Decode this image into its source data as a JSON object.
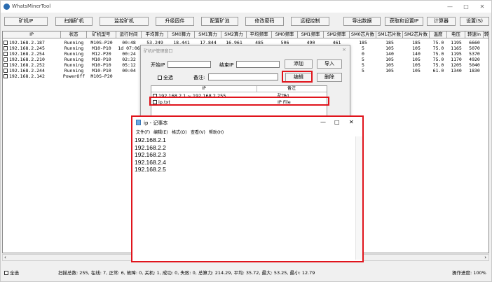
{
  "app": {
    "title": "WhatsMinerTool"
  },
  "window_controls": {
    "minimize": "—",
    "maximize": "□",
    "close": "✕"
  },
  "toolbar": [
    {
      "id": "scan-miner-ip",
      "label": "矿机IP"
    },
    {
      "id": "scan-miner",
      "label": "扫描矿机"
    },
    {
      "id": "monitor-miner",
      "label": "监控矿机"
    },
    {
      "id": "upgrade-firmware",
      "label": "升级固件"
    },
    {
      "id": "config-pool",
      "label": "配置矿池"
    },
    {
      "id": "change-password",
      "label": "修改密码"
    },
    {
      "id": "remote-control",
      "label": "远程控制"
    },
    {
      "id": "export-data",
      "label": "导出数据"
    },
    {
      "id": "get-set-ip",
      "label": "获取和设置IP"
    },
    {
      "id": "calculator",
      "label": "计算器"
    },
    {
      "id": "settings",
      "label": "设置(S)"
    }
  ],
  "table": {
    "headers": [
      "IP",
      "状态",
      "矿机型号",
      "运行时间",
      "平均算力",
      "SM0算力",
      "SM1算力",
      "SM2算力",
      "平均频率",
      "SM0频率",
      "SM1频率",
      "SM2频率",
      "SM0芯片数",
      "SM1芯片数",
      "SM2芯片数",
      "温度",
      "电压",
      "转速In",
      "转"
    ],
    "rows": [
      [
        "192.168.2.187",
        "Running",
        "M10S-P20",
        "00:48",
        "53.249",
        "18.441",
        "17.844",
        "16.961",
        "485",
        "506",
        "490",
        "461",
        "185",
        "185",
        "185",
        "75.0",
        "1195",
        "6660"
      ],
      [
        "192.168.2.245",
        "Running",
        "M10-P10",
        "1d 07:06",
        "",
        "",
        "",
        "",
        "",
        "",
        "",
        "",
        "5",
        "105",
        "105",
        "75.0",
        "1165",
        "5070"
      ],
      [
        "192.168.2.254",
        "Running",
        "M12-P20",
        "00:24",
        "",
        "",
        "",
        "",
        "",
        "",
        "",
        "",
        "0",
        "140",
        "140",
        "75.0",
        "1195",
        "5370"
      ],
      [
        "192.168.2.210",
        "Running",
        "M10-P10",
        "02:32",
        "",
        "",
        "",
        "",
        "",
        "",
        "",
        "",
        "5",
        "105",
        "105",
        "75.0",
        "1170",
        "4920"
      ],
      [
        "192.168.2.252",
        "Running",
        "M10-P10",
        "05:12",
        "",
        "",
        "",
        "",
        "",
        "",
        "",
        "",
        "5",
        "105",
        "105",
        "75.0",
        "1205",
        "5040"
      ],
      [
        "192.168.2.244",
        "Running",
        "M10-P10",
        "00:04",
        "",
        "",
        "",
        "",
        "",
        "",
        "",
        "",
        "5",
        "105",
        "105",
        "61.0",
        "1340",
        "1830"
      ],
      [
        "192.168.2.142",
        "PowerOff",
        "M10S-P20",
        "",
        "",
        "",
        "",
        "",
        "",
        "",
        "",
        "",
        "",
        "",
        "",
        "",
        "",
        ""
      ]
    ]
  },
  "dialog": {
    "title": "矿机IP管理窗口",
    "close": "×",
    "start_ip_label": "开始IP",
    "end_ip_label": "结束IP",
    "add_label": "添加",
    "import_label": "导入",
    "select_all_label": "全选",
    "note_label": "备注:",
    "edit_label": "编辑",
    "delete_label": "删除",
    "list_headers": [
      "IP",
      "备注"
    ],
    "list_rows": [
      {
        "ip": "192.168.2.1 ~ 192.168.2.255",
        "note": "矿场1"
      },
      {
        "ip": "ip.txt",
        "note": "IP File"
      }
    ]
  },
  "notepad": {
    "title": "ip - 记事本",
    "menu": [
      "文件(F)",
      "编辑(E)",
      "格式(O)",
      "查看(V)",
      "帮助(H)"
    ],
    "lines": [
      "192.168.2.1",
      "192.168.2.2",
      "192.168.2.3",
      "192.168.2.4",
      "192.168.2.5"
    ]
  },
  "statusbar": {
    "select_all": "全选",
    "summary": "扫描总数: 255, 在线: 7, 正常: 6, 故障: 0, 关机: 1, 成功: 0, 失败: 0, 总算力: 214.29, 平均: 35.72, 最大: 53.25, 最小: 12.79",
    "progress": "操作进度: 100%"
  },
  "colors": {
    "highlight": "#e0141c"
  }
}
